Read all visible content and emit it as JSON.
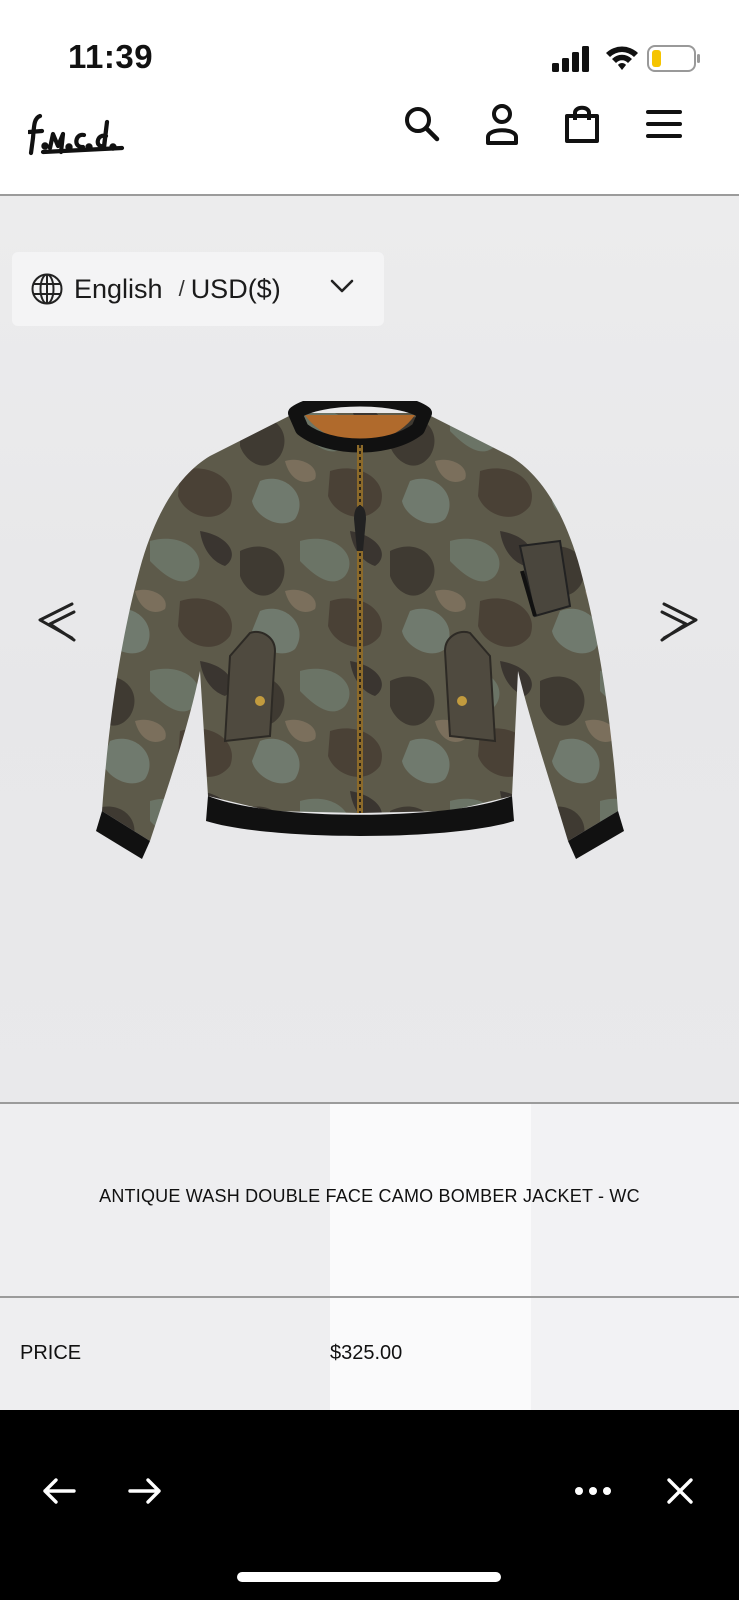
{
  "status_bar": {
    "time": "11:39"
  },
  "header": {
    "logo_text": "f.m.c.d."
  },
  "language_selector": {
    "language": "English",
    "separator": "/",
    "currency": "USD($)"
  },
  "product": {
    "title": "ANTIQUE WASH DOUBLE FACE CAMO BOMBER JACKET - WC",
    "price_label": "PRICE",
    "price_value": "$325.00"
  },
  "colors": {
    "battery_level": "#f5c400",
    "toolbar_bg": "#000000",
    "divider": "#9b9b9b"
  }
}
